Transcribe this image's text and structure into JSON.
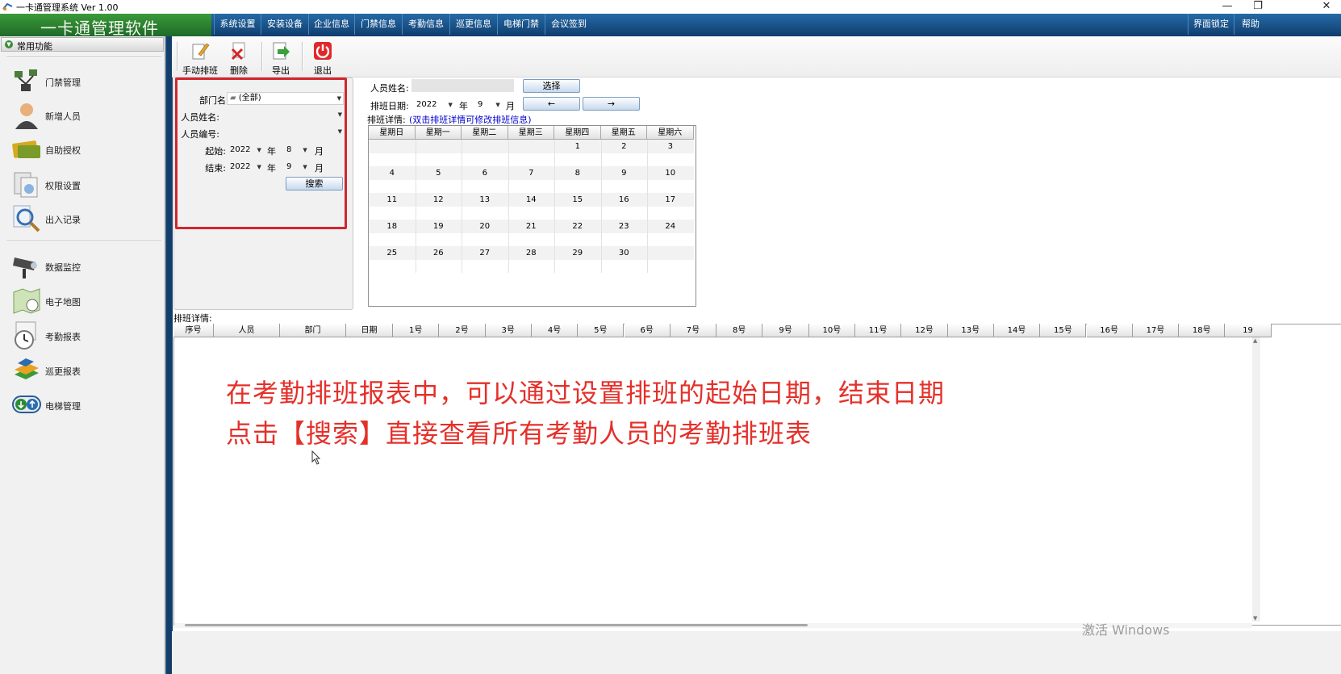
{
  "window": {
    "title": "一卡通管理系统  Ver 1.00",
    "restore_glyph": "❐",
    "close_glyph": "✕"
  },
  "brand": "一卡通管理软件",
  "menu": [
    "系统设置",
    "安装设备",
    "企业信息",
    "门禁信息",
    "考勤信息",
    "巡更信息",
    "电梯门禁",
    "会议签到"
  ],
  "menu_right": [
    "界面锁定",
    "帮助"
  ],
  "sidebar": {
    "header": "常用功能",
    "group1": [
      "门禁管理",
      "新增人员",
      "自助授权",
      "权限设置",
      "出入记录"
    ],
    "group2": [
      "数据监控",
      "电子地图",
      "考勤报表",
      "巡更报表",
      "电梯管理"
    ]
  },
  "toolbar": {
    "manual": "手动排班",
    "delete": "删除",
    "export": "导出",
    "exit": "退出"
  },
  "filter": {
    "dept_label": "部门名",
    "dept_value": "(全部)",
    "name_label": "人员姓名:",
    "id_label": "人员编号:",
    "start_label": "起始:",
    "start_year": "2022",
    "start_month": "8",
    "end_label": "结束:",
    "end_year": "2022",
    "end_month": "9",
    "year_unit": "年",
    "month_unit": "月",
    "search": "搜索"
  },
  "schedule": {
    "name_label": "人员姓名:",
    "select": "选择",
    "date_label": "排班日期:",
    "year": "2022",
    "month": "9",
    "year_unit": "年",
    "month_unit": "月",
    "prev": "←",
    "next": "→",
    "detail_label": "排班详情:",
    "detail_hint": "(双击排班详情可修改排班信息)"
  },
  "calendar": {
    "weekdays": [
      "星期日",
      "星期一",
      "星期二",
      "星期三",
      "星期四",
      "星期五",
      "星期六"
    ],
    "rows": [
      [
        "",
        "",
        "",
        "",
        "1",
        "2",
        "3"
      ],
      [
        "4",
        "5",
        "6",
        "7",
        "8",
        "9",
        "10"
      ],
      [
        "11",
        "12",
        "13",
        "14",
        "15",
        "16",
        "17"
      ],
      [
        "18",
        "19",
        "20",
        "21",
        "22",
        "23",
        "24"
      ],
      [
        "25",
        "26",
        "27",
        "28",
        "29",
        "30",
        ""
      ]
    ]
  },
  "grid": {
    "label": "排班详情:",
    "columns": [
      "序号",
      "人员",
      "部门",
      "日期",
      "1号",
      "2号",
      "3号",
      "4号",
      "5号",
      "6号",
      "7号",
      "8号",
      "9号",
      "10号",
      "11号",
      "12号",
      "13号",
      "14号",
      "15号",
      "16号",
      "17号",
      "18号",
      "19"
    ]
  },
  "caption": {
    "line1": "在考勤排班报表中，可以通过设置排班的起始日期，结束日期",
    "line2": "点击【搜索】直接查看所有考勤人员的考勤排班表"
  },
  "watermark": "激活 Windows",
  "colors": {
    "accent_red": "#d1262e",
    "caption_red": "#e4302a",
    "menu_blue": "#1a4f88",
    "brand_green": "#2e8b34",
    "hint_blue": "#0000cc"
  }
}
